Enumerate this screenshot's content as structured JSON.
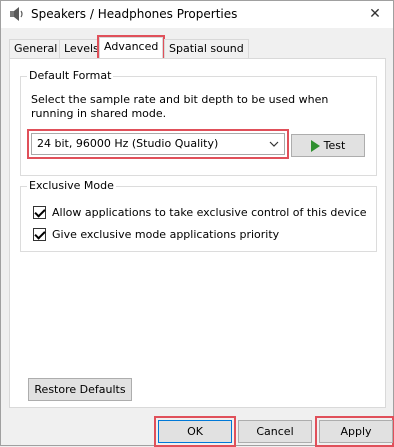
{
  "window": {
    "title": "Speakers / Headphones Properties",
    "close_glyph": "✕"
  },
  "tabs": [
    {
      "label": "General"
    },
    {
      "label": "Levels"
    },
    {
      "label": "Advanced"
    },
    {
      "label": "Spatial sound"
    }
  ],
  "default_format": {
    "title": "Default Format",
    "description": "Select the sample rate and bit depth to be used when running in shared mode.",
    "selected": "24 bit, 96000 Hz (Studio Quality)",
    "test_label": "Test"
  },
  "exclusive_mode": {
    "title": "Exclusive Mode",
    "options": [
      {
        "label": "Allow applications to take exclusive control of this device",
        "checked": true
      },
      {
        "label": "Give exclusive mode applications priority",
        "checked": true
      }
    ]
  },
  "restore_label": "Restore Defaults",
  "footer": {
    "ok": "OK",
    "cancel": "Cancel",
    "apply": "Apply"
  },
  "colors": {
    "highlight": "#e0505a",
    "play": "#2f8f2f",
    "focus": "#0078d7"
  }
}
